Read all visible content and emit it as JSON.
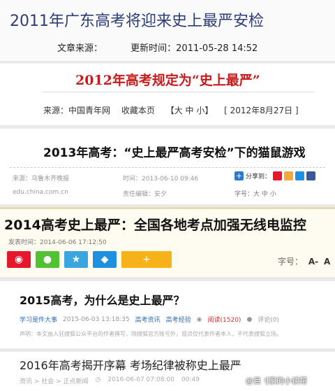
{
  "s1": {
    "title": "2011年广东高考将迎来史上最严安检",
    "source_label": "文章来源：",
    "update": "更新时间：2011-05-28 14:52"
  },
  "s2": {
    "title": "2012年高考规定为“史上最严”",
    "source": "来源：中国青年网",
    "collect": "收藏本页",
    "size": "【大 中 小】",
    "date": "[ 2012年8月27日 ]"
  },
  "s3": {
    "title": "2013年高考：“史上最严高考安检”下的猫鼠游戏",
    "source": "来源：乌鲁木齐晚报",
    "time": "时间：2013-06-10 09:46",
    "site": "edu.china.com.cn",
    "editor": "责任编辑：安夕",
    "share": "分享到：",
    "fontsize": "字号：大 中 小"
  },
  "s4": {
    "title": "2014高考史上最严：全国各地考点加强无线电监控",
    "publish": "发表时间：2014-06-06 17:12:50",
    "fontsize": "字号：",
    "a_minus": "A-",
    "a": "A",
    "a_plus": "A"
  },
  "s5": {
    "title": "2015高考，为什么是史上最严？",
    "author": "学习是件大事",
    "time": "2015-06-03 13:18:35",
    "cat1": "高考资讯",
    "cat2": "高考经验",
    "views": "阅读(1520)",
    "comments": "评论(0)",
    "statement": "声明：本文由入驻搜狐公众平台的作者撰写，除搜狐官方账号外，观点仅代表作者本人，不代表搜狐立场。"
  },
  "s6": {
    "title": "2016年高考揭开序幕 考场纪律被称史上最严",
    "crumb": "资讯 > 社会 > 正点新闻",
    "time": "2016-06-07 07:08:00",
    "duration": "00:49"
  },
  "watermark": "@目刂家的小读帮",
  "colors": {
    "weibo": "#e6162d",
    "wechat": "#51c332",
    "qzone": "#3ba5e0",
    "qq": "#1f8fe0",
    "plus": "#f7b21a",
    "title_blue": "#2d3d78",
    "title_red": "#c81b1b"
  }
}
